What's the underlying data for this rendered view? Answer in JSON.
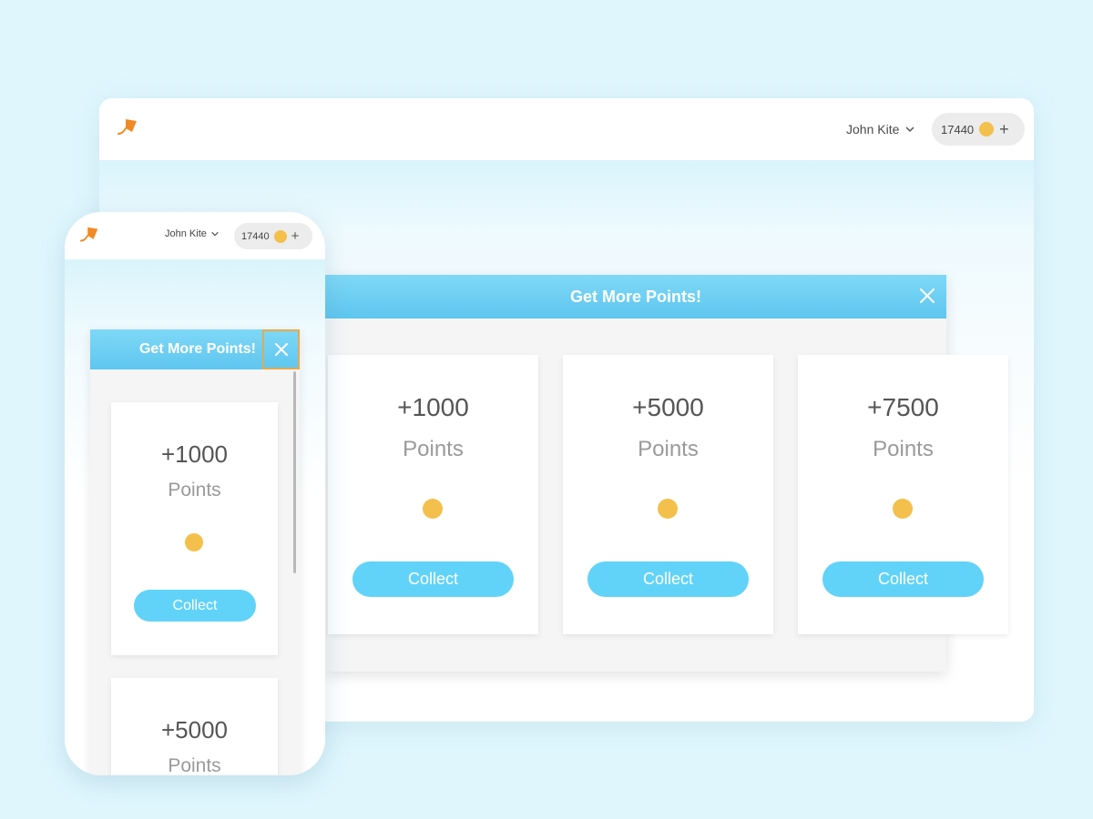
{
  "desktop": {
    "header": {
      "user_name": "John Kite",
      "points": "17440",
      "add_label": "+"
    },
    "modal": {
      "title": "Get More Points!",
      "cards": [
        {
          "amount": "+1000",
          "unit": "Points",
          "button": "Collect"
        },
        {
          "amount": "+5000",
          "unit": "Points",
          "button": "Collect"
        },
        {
          "amount": "+7500",
          "unit": "Points",
          "button": "Collect"
        }
      ]
    }
  },
  "phone": {
    "header": {
      "user_name": "John Kite",
      "points": "17440",
      "add_label": "+"
    },
    "modal": {
      "title": "Get More Points!",
      "cards": [
        {
          "amount": "+1000",
          "unit": "Points",
          "button": "Collect"
        },
        {
          "amount": "+5000",
          "unit": "Points"
        }
      ]
    }
  },
  "colors": {
    "accent": "#62d3f8",
    "coin": "#f4c04c",
    "logo": "#f08a24",
    "background": "#dff6fd"
  },
  "icons": [
    "kite-logo-icon",
    "chevron-down-icon",
    "coin-icon",
    "plus-icon",
    "close-icon"
  ]
}
